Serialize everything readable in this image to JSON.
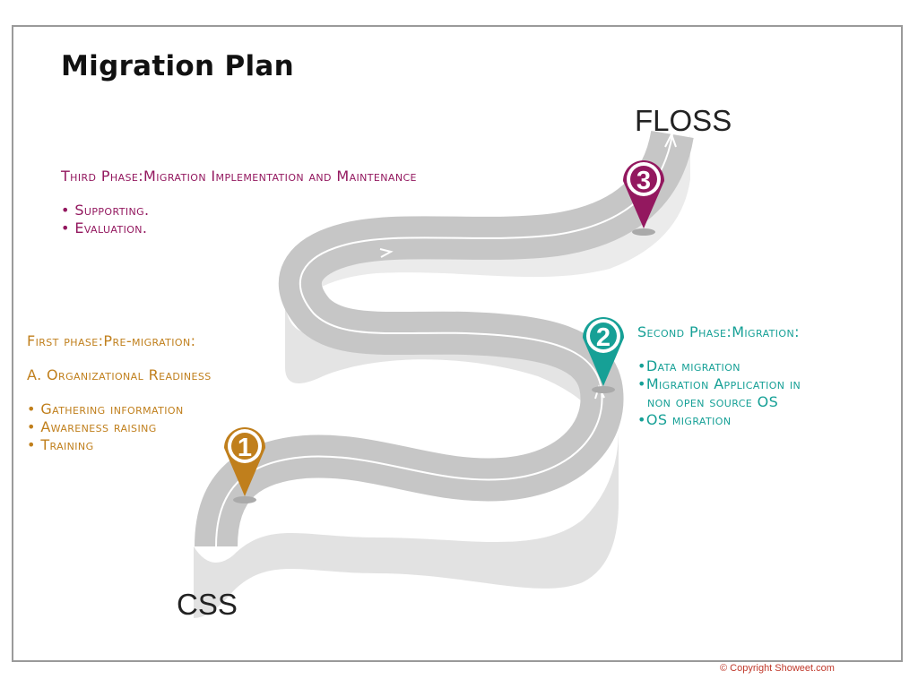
{
  "title": "Migration Plan",
  "endpoints": {
    "start": "CSS",
    "end": "FLOSS"
  },
  "phases": [
    {
      "number": "1",
      "color": "#c07f1c",
      "title": "First phase:Pre-migration:",
      "subtitle": "A. Organizational Readiness",
      "items": [
        "• Gathering information",
        "• Awareness raising",
        "• Training"
      ]
    },
    {
      "number": "2",
      "color": "#16a096",
      "title": "Second Phase:Migration:",
      "items": [
        "•Data migration",
        "•Migration Application in",
        "  non open source OS",
        "•OS migration"
      ]
    },
    {
      "number": "3",
      "color": "#93185f",
      "title": "Third Phase:Migration Implementation and Maintenance",
      "items": [
        "• Supporting.",
        "• Evaluation."
      ]
    }
  ],
  "copyright": "© Copyright Showeet.com"
}
